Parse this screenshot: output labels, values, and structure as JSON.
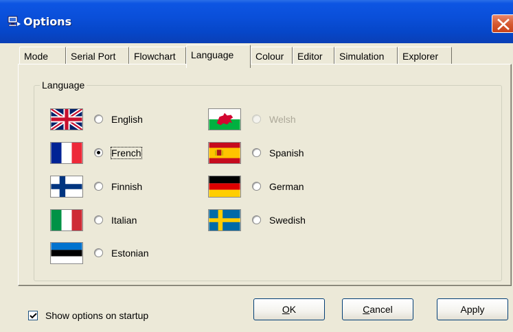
{
  "window": {
    "title": "Options",
    "title_icon": "computer-icon",
    "close_icon": "close-icon"
  },
  "tabs": [
    {
      "label": "Mode"
    },
    {
      "label": "Serial Port"
    },
    {
      "label": "Flowchart"
    },
    {
      "label": "Language",
      "active": true
    },
    {
      "label": "Colour"
    },
    {
      "label": "Editor"
    },
    {
      "label": "Simulation"
    },
    {
      "label": "Explorer"
    }
  ],
  "group": {
    "label": "Language",
    "languages": [
      {
        "label": "English",
        "flag": "uk-flag-icon",
        "selected": false,
        "enabled": true
      },
      {
        "label": "French",
        "flag": "france-flag-icon",
        "selected": true,
        "enabled": true
      },
      {
        "label": "Finnish",
        "flag": "finland-flag-icon",
        "selected": false,
        "enabled": true
      },
      {
        "label": "Italian",
        "flag": "italy-flag-icon",
        "selected": false,
        "enabled": true
      },
      {
        "label": "Estonian",
        "flag": "estonia-flag-icon",
        "selected": false,
        "enabled": true
      },
      {
        "label": "Welsh",
        "flag": "wales-flag-icon",
        "selected": false,
        "enabled": false
      },
      {
        "label": "Spanish",
        "flag": "spain-flag-icon",
        "selected": false,
        "enabled": true
      },
      {
        "label": "German",
        "flag": "germany-flag-icon",
        "selected": false,
        "enabled": true
      },
      {
        "label": "Swedish",
        "flag": "sweden-flag-icon",
        "selected": false,
        "enabled": true
      }
    ]
  },
  "footer": {
    "show_options_label": "Show options on startup",
    "show_options_checked": true,
    "ok_label": "OK",
    "ok_accel": "O",
    "ok_rest": "K",
    "cancel_label": "Cancel",
    "cancel_accel": "C",
    "cancel_rest": "ancel",
    "apply_label": "Apply"
  },
  "colors": {
    "titlebar": "#0a4fd9",
    "close_button": "#d4572e",
    "dialog_background": "#ece9d8",
    "disabled_text": "#aca899"
  }
}
